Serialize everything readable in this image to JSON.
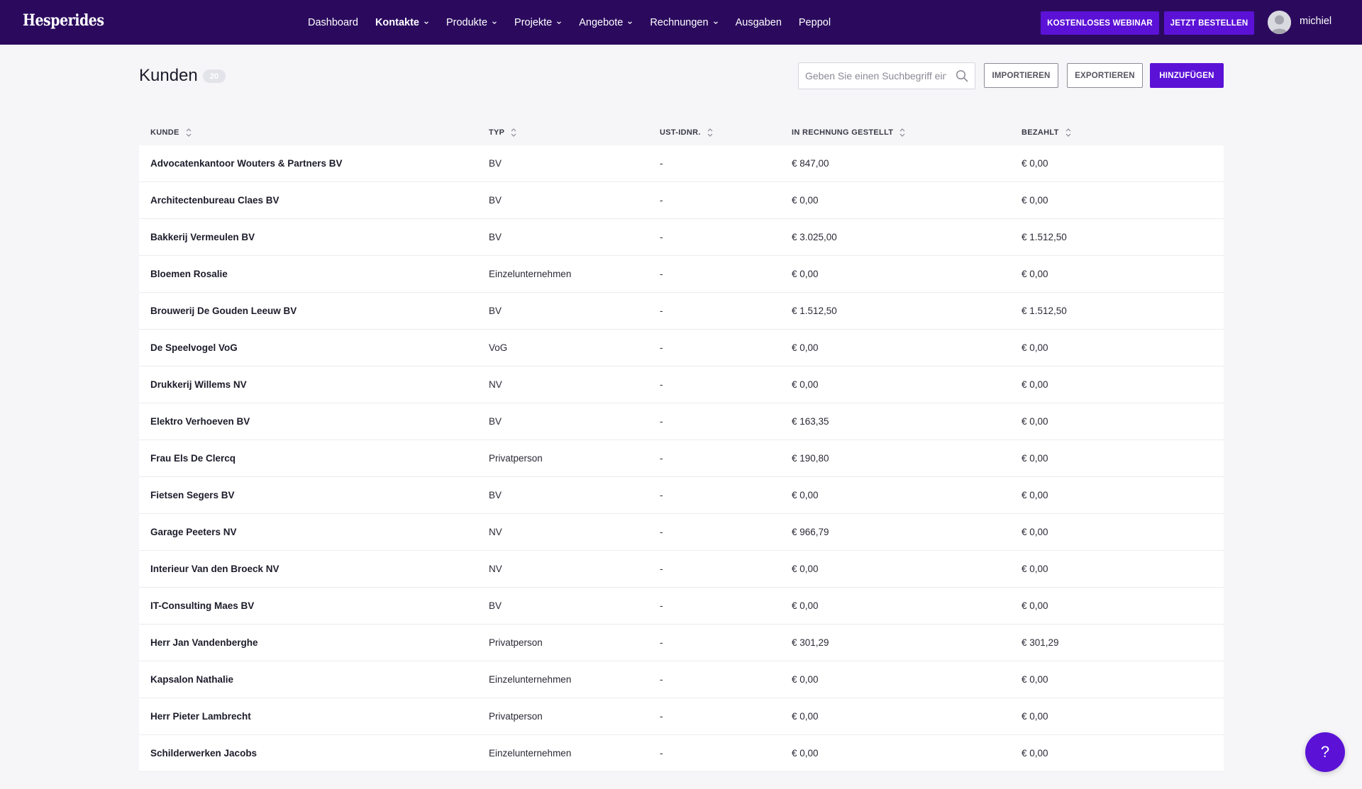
{
  "app": {
    "logo": "Hesperides"
  },
  "nav": {
    "items": [
      {
        "label": "Dashboard",
        "dropdown": false,
        "active": false
      },
      {
        "label": "Kontakte",
        "dropdown": true,
        "active": true
      },
      {
        "label": "Produkte",
        "dropdown": true,
        "active": false
      },
      {
        "label": "Projekte",
        "dropdown": true,
        "active": false
      },
      {
        "label": "Angebote",
        "dropdown": true,
        "active": false
      },
      {
        "label": "Rechnungen",
        "dropdown": true,
        "active": false
      },
      {
        "label": "Ausgaben",
        "dropdown": false,
        "active": false
      },
      {
        "label": "Peppol",
        "dropdown": false,
        "active": false
      }
    ],
    "webinar_label": "KOSTENLOSES WEBINAR",
    "order_label": "JETZT BESTELLEN",
    "username": "michiel"
  },
  "header": {
    "title": "Kunden",
    "count": "20",
    "search_placeholder": "Geben Sie einen Suchbegriff ein.",
    "import_label": "IMPORTIEREN",
    "export_label": "EXPORTIEREN",
    "add_label": "HINZUFÜGEN"
  },
  "table": {
    "columns": [
      "KUNDE",
      "TYP",
      "UST-IDNR.",
      "IN RECHNUNG GESTELLT",
      "BEZAHLT"
    ],
    "rows": [
      [
        "Advocatenkantoor Wouters & Partners BV",
        "BV",
        "-",
        "€ 847,00",
        "€ 0,00"
      ],
      [
        "Architectenbureau Claes BV",
        "BV",
        "-",
        "€ 0,00",
        "€ 0,00"
      ],
      [
        "Bakkerij Vermeulen BV",
        "BV",
        "-",
        "€ 3.025,00",
        "€ 1.512,50"
      ],
      [
        "Bloemen Rosalie",
        "Einzelunternehmen",
        "-",
        "€ 0,00",
        "€ 0,00"
      ],
      [
        "Brouwerij De Gouden Leeuw BV",
        "BV",
        "-",
        "€ 1.512,50",
        "€ 1.512,50"
      ],
      [
        "De Speelvogel VoG",
        "VoG",
        "-",
        "€ 0,00",
        "€ 0,00"
      ],
      [
        "Drukkerij Willems NV",
        "NV",
        "-",
        "€ 0,00",
        "€ 0,00"
      ],
      [
        "Elektro Verhoeven BV",
        "BV",
        "-",
        "€ 163,35",
        "€ 0,00"
      ],
      [
        "Frau Els De Clercq",
        "Privatperson",
        "-",
        "€ 190,80",
        "€ 0,00"
      ],
      [
        "Fietsen Segers BV",
        "BV",
        "-",
        "€ 0,00",
        "€ 0,00"
      ],
      [
        "Garage Peeters NV",
        "NV",
        "-",
        "€ 966,79",
        "€ 0,00"
      ],
      [
        "Interieur Van den Broeck NV",
        "NV",
        "-",
        "€ 0,00",
        "€ 0,00"
      ],
      [
        "IT-Consulting Maes BV",
        "BV",
        "-",
        "€ 0,00",
        "€ 0,00"
      ],
      [
        "Herr Jan Vandenberghe",
        "Privatperson",
        "-",
        "€ 301,29",
        "€ 301,29"
      ],
      [
        "Kapsalon Nathalie",
        "Einzelunternehmen",
        "-",
        "€ 0,00",
        "€ 0,00"
      ],
      [
        "Herr Pieter Lambrecht",
        "Privatperson",
        "-",
        "€ 0,00",
        "€ 0,00"
      ],
      [
        "Schilderwerken Jacobs",
        "Einzelunternehmen",
        "-",
        "€ 0,00",
        "€ 0,00"
      ]
    ]
  },
  "help": {
    "label": "?"
  },
  "colors": {
    "topbar": "#2b0a5e",
    "accent": "#5b12d6",
    "background": "#f6f6f8"
  }
}
